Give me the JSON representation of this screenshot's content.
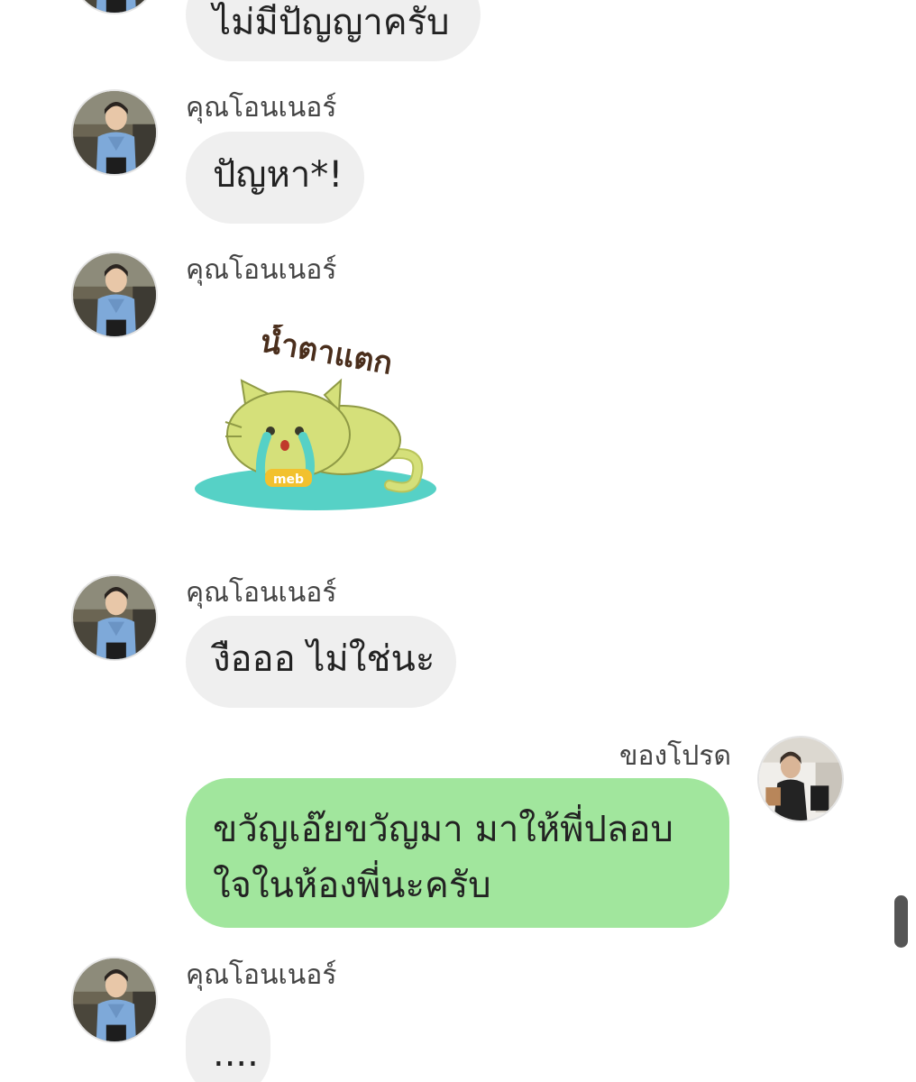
{
  "chat": {
    "other_name": "คุณโอนเนอร์",
    "self_name": "ของโปรด",
    "messages": [
      {
        "text": "ไม่มีปัญญาครับ"
      },
      {
        "text": "ปัญหา*!"
      },
      {
        "sticker_text": "น้ำตาแตก",
        "sticker_badge": "meb"
      },
      {
        "text": "งือออ ไม่ใช่นะ"
      },
      {
        "text": "ขวัญเอ๊ยขวัญมา มาให้พี่ปลอบใจในห้องพี่นะครับ"
      },
      {
        "text": "...."
      }
    ]
  },
  "colors": {
    "incoming_bubble": "#efefef",
    "outgoing_bubble": "#a1e69d",
    "sticker_cat": "#d5e07a",
    "sticker_tears": "#56d1c6"
  }
}
